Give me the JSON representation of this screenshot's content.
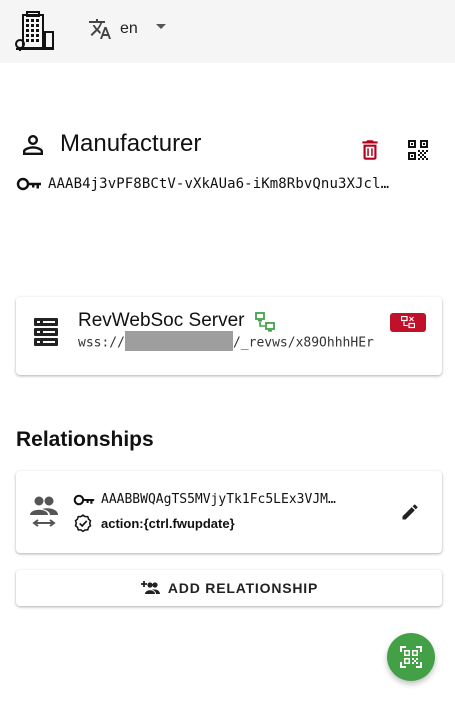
{
  "topbar": {
    "logo_icon": "building-icon",
    "language_icon": "translate-icon",
    "language": "en",
    "dropdown_icon": "caret-down-icon"
  },
  "identity": {
    "icon": "person-icon",
    "title": "Manufacturer",
    "delete_icon": "trash-icon",
    "delete_color": "#b3001b",
    "qr_icon": "qr-code-icon",
    "key_icon": "key-icon",
    "public_key": "AAAB4j3vPF8BCtV-vXkAUa6-iKm8RbvQnu3XJcl…"
  },
  "server": {
    "icon": "server-icon",
    "name": "RevWebSoc Server",
    "connection_icon": "connection-status-icon",
    "connection_color": "#43a047",
    "url_prefix": "wss://",
    "url_suffix": "/_revws/x89OhhhHEr",
    "badge_icon": "disconnect-icon",
    "badge_color": "#c0102a"
  },
  "relationships": {
    "heading": "Relationships",
    "items": [
      {
        "icon": "group-exchange-icon",
        "key_icon": "key-icon",
        "key": "AAABBWQAgTS5MVjyTk1Fc5LEx3VJM…",
        "action_icon": "verified-icon",
        "action": "action:{ctrl.fwupdate}",
        "edit_icon": "pencil-icon"
      }
    ],
    "add_icon": "add-group-icon",
    "add_label": "ADD RELATIONSHIP"
  },
  "fab": {
    "icon": "qr-scan-icon",
    "color": "#43a047"
  }
}
